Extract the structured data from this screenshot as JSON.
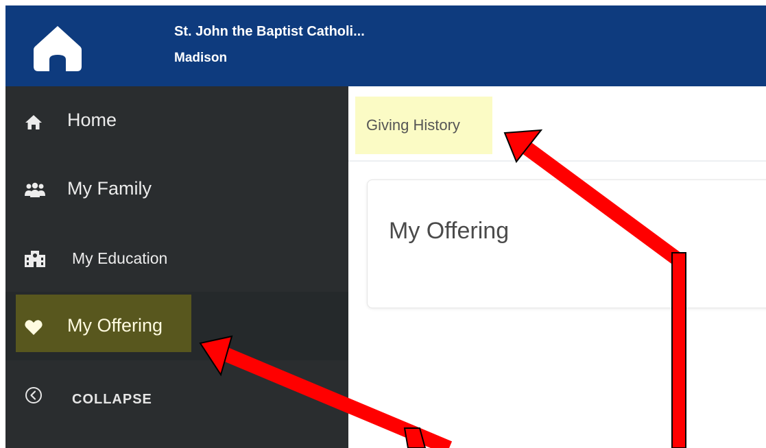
{
  "header": {
    "logo_icon": "home-icon",
    "org_name": "St. John the Baptist Catholi...",
    "city": "Madison",
    "background": "#0e3b7e"
  },
  "sidebar": {
    "items": [
      {
        "label": "Home",
        "icon": "home-icon",
        "active": false
      },
      {
        "label": "My Family",
        "icon": "users-icon",
        "active": false
      },
      {
        "label": "My Education",
        "icon": "school-icon",
        "active": false
      },
      {
        "label": "My Offering",
        "icon": "heart-icon",
        "active": true
      }
    ],
    "collapse_label": "COLLAPSE",
    "collapse_icon": "chevron-left-circle-icon",
    "background": "#2a2d2f"
  },
  "main": {
    "tabs": [
      {
        "label": "Giving History",
        "active": true
      }
    ],
    "card_title": "My Offering"
  },
  "annotations": {
    "arrow_color": "#ff0000",
    "highlight_color": "#fbfbc5"
  }
}
